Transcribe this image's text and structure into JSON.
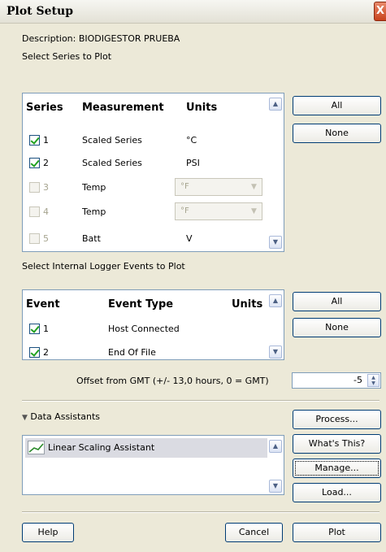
{
  "window": {
    "title": "Plot Setup",
    "close_glyph": "X"
  },
  "description": {
    "label": "Description: BIODIGESTOR PRUEBA"
  },
  "series_section": {
    "label": "Select Series to Plot",
    "headers": {
      "series": "Series",
      "measurement": "Measurement",
      "units": "Units"
    },
    "rows": [
      {
        "num": "1",
        "measurement": "Scaled Series",
        "units": "°C",
        "checked": true,
        "enabled": true
      },
      {
        "num": "2",
        "measurement": "Scaled Series",
        "units": "PSI",
        "checked": true,
        "enabled": true
      },
      {
        "num": "3",
        "measurement": "Temp",
        "units": "°F",
        "checked": false,
        "enabled": false
      },
      {
        "num": "4",
        "measurement": "Temp",
        "units": "°F",
        "checked": false,
        "enabled": false
      },
      {
        "num": "5",
        "measurement": "Batt",
        "units": "V",
        "checked": false,
        "enabled": false
      }
    ],
    "all_label": "All",
    "none_label": "None"
  },
  "events_section": {
    "label": "Select Internal Logger Events to Plot",
    "headers": {
      "event": "Event",
      "type": "Event Type",
      "units": "Units"
    },
    "rows": [
      {
        "num": "1",
        "type": "Host Connected",
        "checked": true
      },
      {
        "num": "2",
        "type": "End Of File",
        "checked": true
      }
    ],
    "all_label": "All",
    "none_label": "None"
  },
  "offset": {
    "label": "Offset from GMT (+/- 13,0 hours, 0 = GMT)",
    "value": "-5"
  },
  "assistants": {
    "label": "Data Assistants",
    "items": [
      {
        "label": "Linear Scaling Assistant"
      }
    ],
    "process_label": "Process...",
    "whats_this_label": "What's This?",
    "manage_label": "Manage...",
    "load_label": "Load..."
  },
  "footer": {
    "help_label": "Help",
    "cancel_label": "Cancel",
    "plot_label": "Plot"
  }
}
